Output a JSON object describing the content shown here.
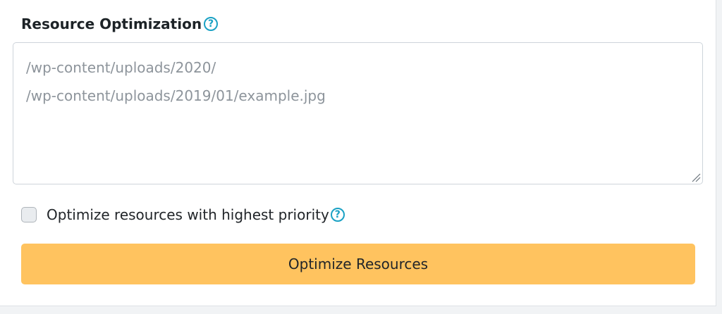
{
  "section": {
    "title": "Resource Optimization",
    "help_icon": "question-circle-icon"
  },
  "paths_field": {
    "value": "",
    "placeholder": "/wp-content/uploads/2020/\n/wp-content/uploads/2019/01/example.jpg"
  },
  "priority_option": {
    "label": "Optimize resources with highest priority",
    "checked": false,
    "help_icon": "question-circle-icon"
  },
  "action_button": {
    "label": "Optimize Resources"
  },
  "colors": {
    "button_bg": "#ffc35f",
    "help_icon": "#1aa1c4",
    "placeholder": "#8d949b"
  }
}
